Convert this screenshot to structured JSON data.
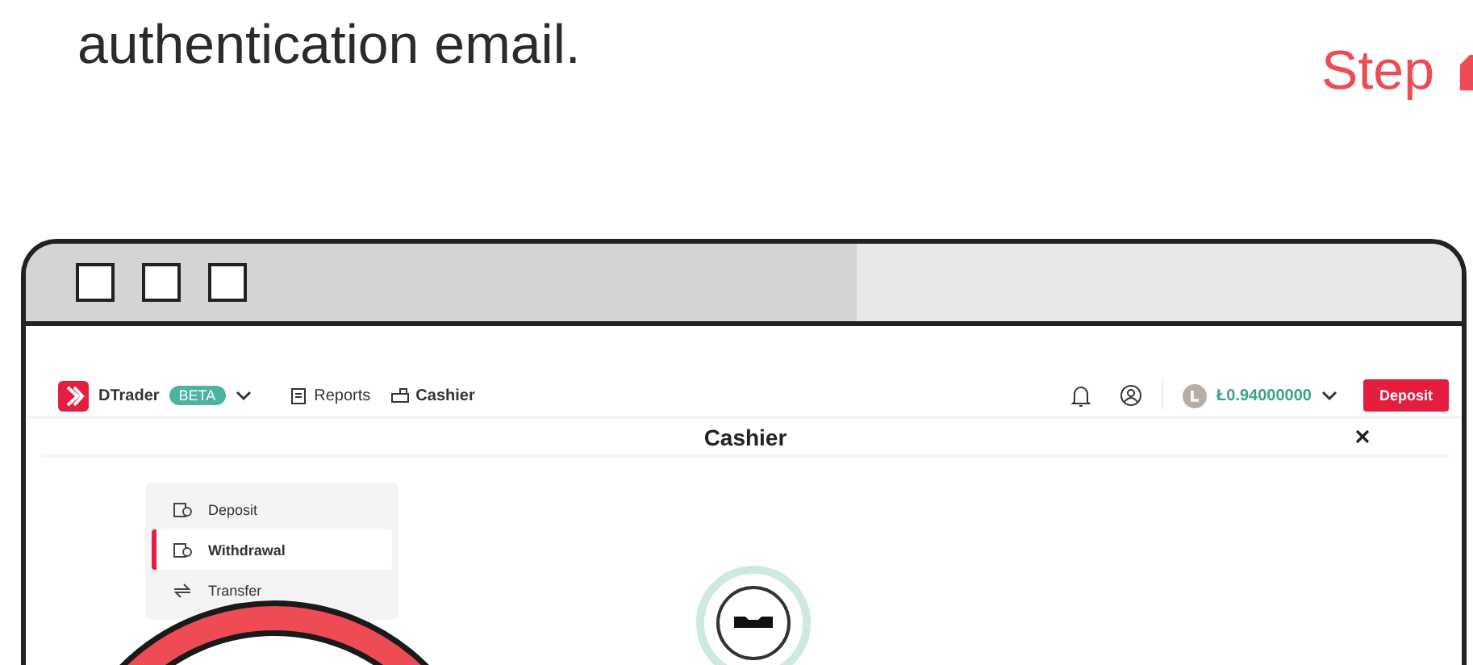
{
  "intro": {
    "text": "authentication email.",
    "step_label": "Step"
  },
  "app_header": {
    "brand": "DTrader",
    "badge": "BETA",
    "nav": [
      {
        "label": "Reports",
        "selected": false
      },
      {
        "label": "Cashier",
        "selected": true
      }
    ],
    "balance": "Ł0.94000000",
    "deposit_button": "Deposit"
  },
  "cashier": {
    "title": "Cashier",
    "menu": [
      {
        "label": "Deposit",
        "selected": false
      },
      {
        "label": "Withdrawal",
        "selected": true
      },
      {
        "label": "Transfer",
        "selected": false
      }
    ]
  }
}
